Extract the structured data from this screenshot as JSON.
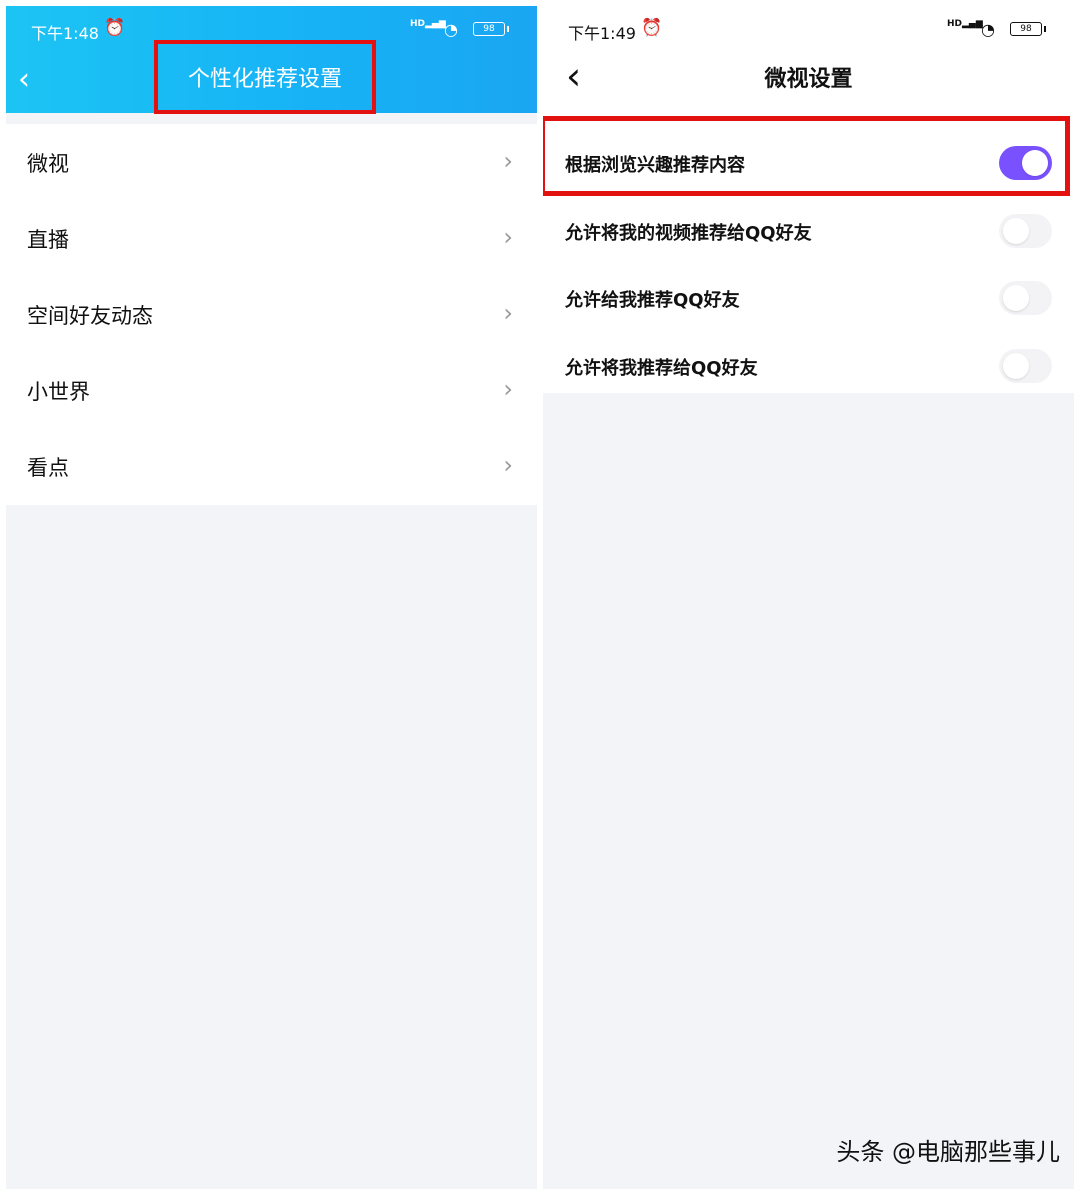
{
  "left": {
    "status": {
      "time": "下午1:48",
      "battery": "98"
    },
    "title": "个性化推荐设置",
    "items": [
      {
        "label": "微视"
      },
      {
        "label": "直播"
      },
      {
        "label": "空间好友动态"
      },
      {
        "label": "小世界"
      },
      {
        "label": "看点"
      }
    ]
  },
  "right": {
    "status": {
      "time": "下午1:49",
      "battery": "98"
    },
    "title": "微视设置",
    "settings": [
      {
        "label": "根据浏览兴趣推荐内容",
        "enabled": true
      },
      {
        "label": "允许将我的视频推荐给QQ好友",
        "enabled": false
      },
      {
        "label": "允许给我推荐QQ好友",
        "enabled": false
      },
      {
        "label": "允许将我推荐给QQ好友",
        "enabled": false
      }
    ]
  },
  "watermark": "头条 @电脑那些事儿",
  "colors": {
    "header_blue": "#1ab7f4",
    "highlight_red": "#e41111",
    "toggle_on": "#7a51ff",
    "background": "#f3f4f8"
  }
}
